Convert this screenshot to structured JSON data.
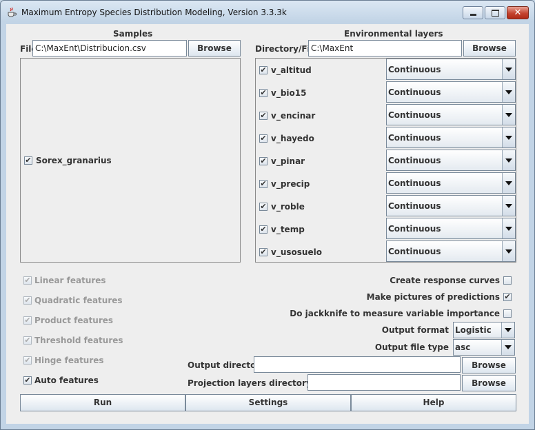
{
  "window": {
    "title": "Maximum Entropy Species Distribution Modeling, Version 3.3.3k"
  },
  "samples": {
    "header": "Samples",
    "file_label": "File",
    "file_value": "C:\\MaxEnt\\Distribucion.csv",
    "browse_label": "Browse",
    "species": [
      {
        "name": "Sorex_granarius",
        "checked": true
      }
    ]
  },
  "env": {
    "header": "Environmental layers",
    "dir_label": "Directory/File",
    "dir_value": "C:\\MaxEnt",
    "browse_label": "Browse",
    "layers": [
      {
        "name": "v_altitud",
        "type": "Continuous",
        "checked": true
      },
      {
        "name": "v_bio15",
        "type": "Continuous",
        "checked": true
      },
      {
        "name": "v_encinar",
        "type": "Continuous",
        "checked": true
      },
      {
        "name": "v_hayedo",
        "type": "Continuous",
        "checked": true
      },
      {
        "name": "v_pinar",
        "type": "Continuous",
        "checked": true
      },
      {
        "name": "v_precip",
        "type": "Continuous",
        "checked": true
      },
      {
        "name": "v_roble",
        "type": "Continuous",
        "checked": true
      },
      {
        "name": "v_temp",
        "type": "Continuous",
        "checked": true
      },
      {
        "name": "v_usosuelo",
        "type": "Continuous",
        "checked": true
      }
    ]
  },
  "features": {
    "linear": "Linear features",
    "quadratic": "Quadratic features",
    "product": "Product features",
    "threshold": "Threshold features",
    "hinge": "Hinge features",
    "auto": "Auto features"
  },
  "options": {
    "response_curves": "Create response curves",
    "pictures": "Make pictures of predictions",
    "jackknife": "Do jackknife to measure variable importance",
    "output_format_label": "Output format",
    "output_format_value": "Logistic",
    "output_type_label": "Output file type",
    "output_type_value": "asc",
    "output_dir_label": "Output directory",
    "output_dir_value": "",
    "projection_label": "Projection layers directory/file",
    "projection_value": "",
    "browse_label": "Browse"
  },
  "actions": {
    "run": "Run",
    "settings": "Settings",
    "help": "Help"
  },
  "check_glyph": "✔"
}
